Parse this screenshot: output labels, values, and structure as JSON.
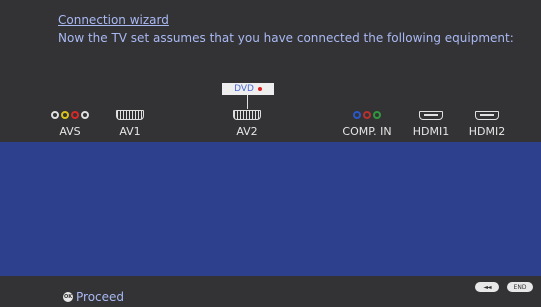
{
  "wizard": {
    "title": "Connection wizard",
    "subtitle": "Now the TV set assumes that you have connected the following equipment:"
  },
  "connectors": [
    {
      "label": "AVS",
      "icon": "avs-connector-icon"
    },
    {
      "label": "AV1",
      "icon": "scart-icon"
    },
    {
      "label": "AV2",
      "icon": "scart-icon"
    },
    {
      "label": "COMP. IN",
      "icon": "component-rca-icon"
    },
    {
      "label": "HDMI1",
      "icon": "hdmi-icon"
    },
    {
      "label": "HDMI2",
      "icon": "hdmi-icon"
    }
  ],
  "device_tag": {
    "label": "DVD",
    "connected_to": "AV2"
  },
  "footer": {
    "proceed_label": "Proceed",
    "ok_glyph": "OK",
    "rewind_glyph": "◄◄",
    "end_label": "END"
  },
  "colors": {
    "background": "#333335",
    "panel": "#2d408e",
    "link_text": "#a9b9f3",
    "rca_yellow": "#d8c21a",
    "rca_red": "#d82828",
    "rca_white": "#e0e0e0",
    "comp_blue": "#2a58c8",
    "comp_red": "#b83030",
    "comp_green": "#2f9a3c"
  }
}
